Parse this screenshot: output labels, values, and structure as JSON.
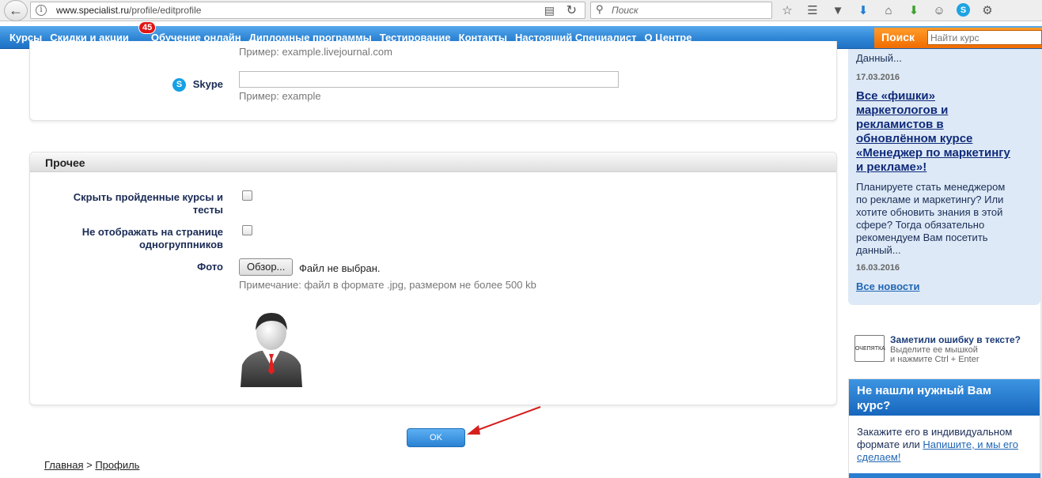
{
  "browser": {
    "url_domain": "www.specialist.ru",
    "url_path": "/profile/editprofile",
    "search_placeholder": "Поиск"
  },
  "nav": {
    "items": [
      {
        "label": "Курсы"
      },
      {
        "label": "Скидки и акции"
      },
      {
        "label": "Обучение онлайн"
      },
      {
        "label": "Дипломные программы"
      },
      {
        "label": "Тестирование"
      },
      {
        "label": "Контакты"
      },
      {
        "label": "Настоящий Специалист"
      },
      {
        "label": "О Центре"
      }
    ],
    "badge": "45",
    "search_label": "Поиск",
    "search_placeholder": "Найти курс"
  },
  "contacts": {
    "prev_hint": "Пример: example.livejournal.com",
    "skype_label": "Skype",
    "skype_value": "",
    "skype_hint": "Пример: example"
  },
  "other": {
    "title": "Прочее",
    "hide_courses_label_1": "Скрыть пройденные курсы и",
    "hide_courses_label_2": "тесты",
    "hide_groupmates_label_1": "Не отображать на странице",
    "hide_groupmates_label_2": "одногруппников",
    "photo_label": "Фото",
    "browse_button": "Обзор...",
    "file_status": "Файл не выбран.",
    "photo_note": "Примечание: файл в формате .jpg, размером не более 500 kb"
  },
  "form": {
    "ok_label": "OK"
  },
  "breadcrumb": {
    "home": "Главная",
    "separator": ">",
    "current": "Профиль"
  },
  "sidebar": {
    "news_top_1": "Данный...",
    "date_1": "17.03.2016",
    "news_title_lines": [
      "Все «фишки»",
      "маркетологов и",
      "рекламистов в",
      "обновлённом курсе",
      "«Менеджер по маркетингу",
      "и рекламе»!"
    ],
    "news_body_lines": [
      "Планируете стать менеджером",
      "по рекламе и маркетингу? Или",
      "хотите обновить знания в этой",
      "сфере? Тогда обязательно",
      "рекомендуем Вам посетить",
      "данный..."
    ],
    "date_2": "16.03.2016",
    "all_news": "Все новости",
    "typo_logo": "ОЧЕПЯТКА",
    "typo_title": "Заметили ошибку в тексте?",
    "typo_line_1": "Выделите ее мышкой",
    "typo_line_2": "и нажмите Ctrl + Enter",
    "custom_title_1": "Не нашли нужный Вам",
    "custom_title_2": "курс?",
    "custom_text": "Закажите его в индивидуальном формате или ",
    "custom_link": "Напишите, и мы его сделаем!"
  }
}
